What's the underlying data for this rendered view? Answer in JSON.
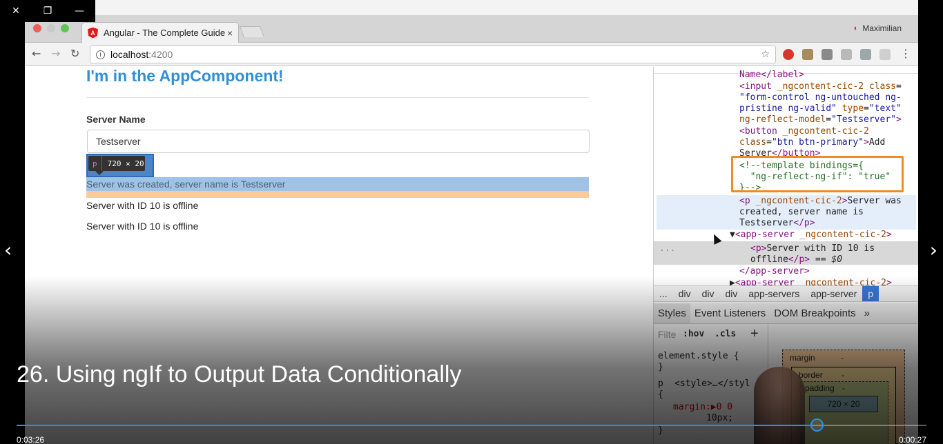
{
  "player": {
    "window_controls": [
      "✕",
      "❐",
      "—"
    ],
    "title": "26. Using ngIf to Output Data Conditionally",
    "time_elapsed": "0:03:26",
    "time_remaining": "0:00:27",
    "progress": 0.88,
    "prev_arrow": "‹",
    "next_arrow": "›",
    "accent_color": "#2d8ee8"
  },
  "browser": {
    "tab_title": "Angular - The Complete Guide",
    "tab_close": "×",
    "profile_name": "Maximilian",
    "url_host": "localhost",
    "url_port": ":4200",
    "back_icon": "←",
    "forward_icon": "→",
    "reload_icon": "↻",
    "star_icon": "☆",
    "menu_icon": "⋮"
  },
  "page": {
    "heading": "I'm in the AppComponent!",
    "server_name_label": "Server Name",
    "server_name_value": "Testserver",
    "tooltip_tag": "p",
    "tooltip_dims": "720 × 20",
    "created_message": "Server was created, server name is Testserver",
    "offline_1": "Server with ID 10 is offline",
    "offline_2": "Server with ID 10 is offline",
    "heading_color": "#2e8fd8"
  },
  "devtools": {
    "breadcrumb": [
      "...",
      "div",
      "div",
      "div",
      "app-servers",
      "app-server",
      "p"
    ],
    "subtabs": [
      "Styles",
      "Event Listeners",
      "DOM Breakpoints",
      "»"
    ],
    "filter_placeholder": "Filte",
    "hov": ":hov",
    "cls": ".cls",
    "plus": "+",
    "element_style": "element.style {",
    "close_brace": "}",
    "rule_selector": "p",
    "rule_source": "<style>…</styl",
    "rule_open": "{",
    "margin_decl": "margin:▶0 0",
    "margin_decl_cont": "10px;",
    "box_margin": "margin",
    "box_border": "border",
    "box_padding": "padding",
    "box_content": "720 × 20",
    "box_dash": "-",
    "ellipsis": "..."
  }
}
